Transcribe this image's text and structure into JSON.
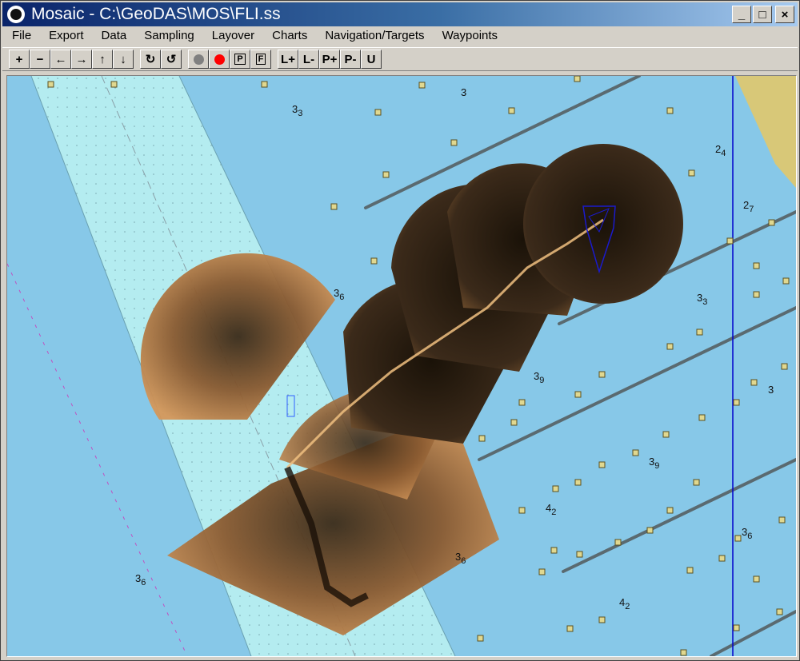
{
  "window": {
    "title": "Mosaic - C:\\GeoDAS\\MOS\\FLI.ss"
  },
  "titlebar_buttons": [
    {
      "name": "minimize-button",
      "label": "_"
    },
    {
      "name": "maximize-button",
      "label": "□"
    },
    {
      "name": "close-button",
      "label": "×"
    }
  ],
  "menu": [
    "File",
    "Export",
    "Data",
    "Sampling",
    "Layover",
    "Charts",
    "Navigation/Targets",
    "Waypoints"
  ],
  "toolbar": {
    "nav": [
      "+",
      "−",
      "←",
      "→",
      "↑",
      "↓"
    ],
    "rotate": [
      "↻",
      "↺"
    ],
    "record_colors": {
      "stop": "#808080",
      "record": "#ff0000"
    },
    "boxed": [
      "P",
      "F"
    ],
    "layer": [
      "L+",
      "L-",
      "P+",
      "P-",
      "U"
    ]
  },
  "map": {
    "colors": {
      "water": "#87c8e8",
      "channel": "#b4ecf0",
      "land": "#d8c878",
      "route": "#0000cc",
      "buoy": "#e0d890"
    },
    "soundings": [
      {
        "main": "3",
        "sub": "3"
      },
      {
        "main": "3",
        "sub": ""
      },
      {
        "main": "2",
        "sub": "4"
      },
      {
        "main": "2",
        "sub": "7"
      },
      {
        "main": "3",
        "sub": "3"
      },
      {
        "main": "3",
        "sub": "6"
      },
      {
        "main": "3",
        "sub": ""
      },
      {
        "main": "3",
        "sub": "9"
      },
      {
        "main": "3",
        "sub": "9"
      },
      {
        "main": "4",
        "sub": "2"
      },
      {
        "main": "3",
        "sub": "6"
      },
      {
        "main": "4",
        "sub": "2"
      },
      {
        "main": "3",
        "sub": "6"
      },
      {
        "main": "3",
        "sub": "6"
      }
    ]
  }
}
